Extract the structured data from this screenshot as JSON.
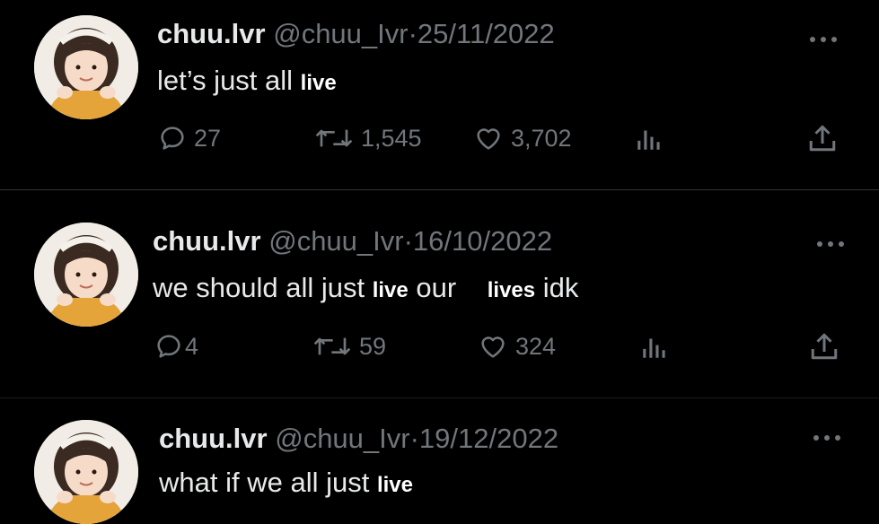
{
  "colors": {
    "background": "#000000",
    "text": "#e7e9ea",
    "muted": "#71767b",
    "divider": "#2f3336"
  },
  "tweets": [
    {
      "name": "chuu.lvr",
      "handle": "@chuu_Ivr",
      "separator": "·",
      "date": "25/11/2022",
      "text_parts": [
        "let’s just all ",
        "live",
        "",
        "",
        ""
      ],
      "replies": "27",
      "retweets": "1,545",
      "likes": "3,702"
    },
    {
      "name": "chuu.lvr",
      "handle": "@chuu_Ivr",
      "separator": "·",
      "date": "16/10/2022",
      "text_parts": [
        "we should all just ",
        "live",
        " our ",
        "lives",
        " idk"
      ],
      "replies": "4",
      "retweets": "59",
      "likes": "324"
    },
    {
      "name": "chuu.lvr",
      "handle": "@chuu_Ivr",
      "separator": "·",
      "date": "19/12/2022",
      "text_parts": [
        "what if we all just ",
        "live",
        "",
        "",
        ""
      ]
    }
  ],
  "icons": {
    "reply": "reply-icon",
    "retweet": "retweet-icon",
    "like": "heart-icon",
    "views": "views-icon",
    "share": "share-icon",
    "more": "more-icon"
  }
}
